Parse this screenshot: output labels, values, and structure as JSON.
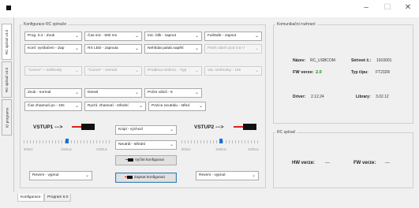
{
  "window": {
    "minimize": "–",
    "maximize": "☐",
    "close": "✕"
  },
  "side_tabs": [
    "RC spínač v3.0",
    "RC spínač v4.0",
    "IO programu"
  ],
  "config": {
    "title": "Konfigurace RC spínače",
    "row1": [
      "Prog. 0.2 - Zvuk",
      "Čas inic - 500 ms",
      "Inic. blik - zapnut",
      "FailSafe - zapnut"
    ],
    "row2": [
      "Konf. vysílačem - Zap",
      "RX LED - zapnuta",
      "Nehlídat palub.napětí",
      "Flesh alarm pod 4.5 V"
    ],
    "row3": [
      "\"Corner\" + světlovky",
      "\"Corner\" - normal",
      "Prodleva směrov. - Vyp",
      "Var. směrovky - 10s"
    ],
    "row4": [
      "Zvuk - normal",
      "Diesel",
      "Počet válců - 6"
    ],
    "row5": [
      "Čas zhasnutí po - 10s",
      "Rychl. zhasnutí - střední",
      "Pozice neutrálu - střed"
    ],
    "vstup1": "VSTUP1 --->",
    "vstup2": "VSTUP2 --->",
    "knipl": "Knipl - výchozí",
    "neutral": "Neutrál - střední",
    "read_btn": "Vyčíst konfiguraci",
    "write_btn": "Zapsat konfiguraci",
    "revers1": "Revers - vypnut",
    "revers2": "Revers - vypnut",
    "scale1": [
      "800us",
      "1500us",
      "2200us"
    ],
    "scale2": [
      "800us",
      "1500us",
      "2200us"
    ],
    "slider1_thumb": 0.5,
    "slider2_thumb": 0.5
  },
  "comm": {
    "title": "Komunikační rozhraní",
    "name_label": "Název:",
    "name_value": "RC_USBCOM",
    "serial_label": "Sériové č.:",
    "serial_value": "1910001",
    "fw_label": "FW verze:",
    "fw_value": "2.0",
    "chip_label": "Typ čipu:",
    "chip_value": "FT232R",
    "driver_label": "Driver:",
    "driver_value": "2.12.24",
    "library_label": "Library:",
    "library_value": "3.02.12"
  },
  "rc": {
    "title": "RC spínač",
    "hw_label": "HW verze:",
    "hw_value": "---",
    "fw_label": "FW verze:",
    "fw_value": "---"
  },
  "bottom_tabs": [
    "Konfigurace",
    "Program 6.0"
  ],
  "colors": {
    "fw_green": "#1a8a1a",
    "accent": "#1a6fdc"
  }
}
